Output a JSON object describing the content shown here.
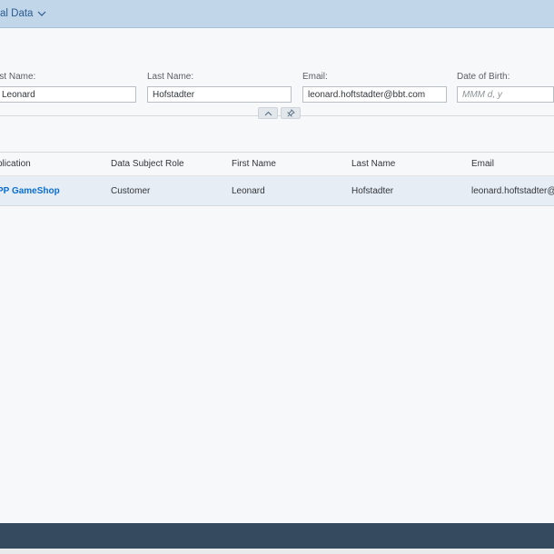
{
  "header": {
    "app_title": "al Data",
    "menu_icon": "chevron-down-icon"
  },
  "filters": {
    "first_name_label": "rst Name:",
    "first_name_value": "Leonard",
    "last_name_label": "Last Name:",
    "last_name_value": "Hofstadter",
    "email_label": "Email:",
    "email_value": "leonard.hoftstadter@bbt.com",
    "dob_label": "Date of Birth:",
    "dob_placeholder": "MMM d, y",
    "collapse_icon": "chevron-up-icon",
    "pin_icon": "pin-icon"
  },
  "table": {
    "columns": [
      "plication",
      "Data Subject Role",
      "First Name",
      "Last Name",
      "Email"
    ],
    "rows": [
      {
        "application": "PP GameShop",
        "role": "Customer",
        "first_name": "Leonard",
        "last_name": "Hofstadter",
        "email": "leonard.hoftstadter@b"
      }
    ]
  },
  "colors": {
    "shellbar": "#c2d6ea",
    "link": "#0a6ed1",
    "footer": "#354a5f",
    "row_selected": "#e7edf4"
  }
}
